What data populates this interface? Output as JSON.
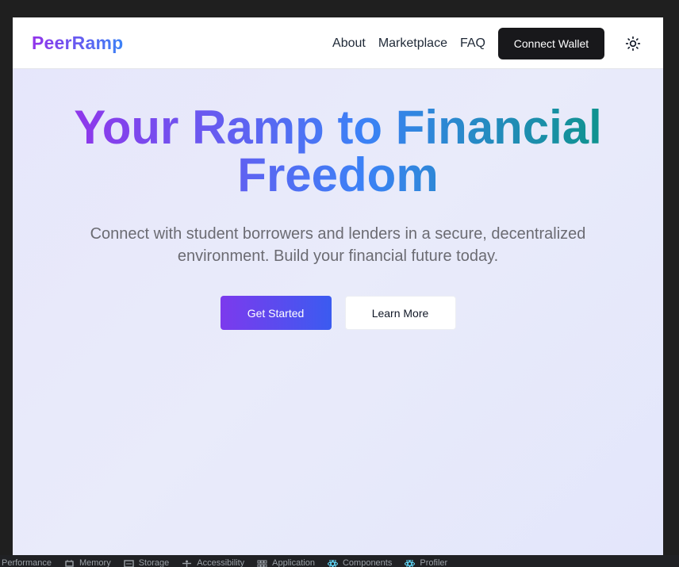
{
  "navbar": {
    "brand": "PeerRamp",
    "links": [
      "About",
      "Marketplace",
      "FAQ"
    ],
    "connect_wallet": "Connect Wallet",
    "theme_icon": "sun-icon"
  },
  "hero": {
    "title_line1": "Your Ramp to Financial",
    "title_line2": "Freedom",
    "subtitle": "Connect with student borrowers and lenders in a secure, decentralized environment. Build your financial future today.",
    "primary_button": "Get Started",
    "secondary_button": "Learn More"
  },
  "devtools": {
    "tabs": [
      {
        "label": "Performance",
        "icon": "performance-icon"
      },
      {
        "label": "Memory",
        "icon": "memory-icon"
      },
      {
        "label": "Storage",
        "icon": "storage-icon"
      },
      {
        "label": "Accessibility",
        "icon": "accessibility-icon"
      },
      {
        "label": "Application",
        "icon": "application-icon"
      },
      {
        "label": "Components",
        "icon": "react-icon"
      },
      {
        "label": "Profiler",
        "icon": "react-icon"
      }
    ]
  },
  "colors": {
    "brand_gradient_start": "#9333ea",
    "brand_gradient_end": "#3b82f6",
    "title_gradient_end": "#0d9488",
    "connect_button_bg": "#18181b",
    "page_bg": "#e6e6fb"
  }
}
